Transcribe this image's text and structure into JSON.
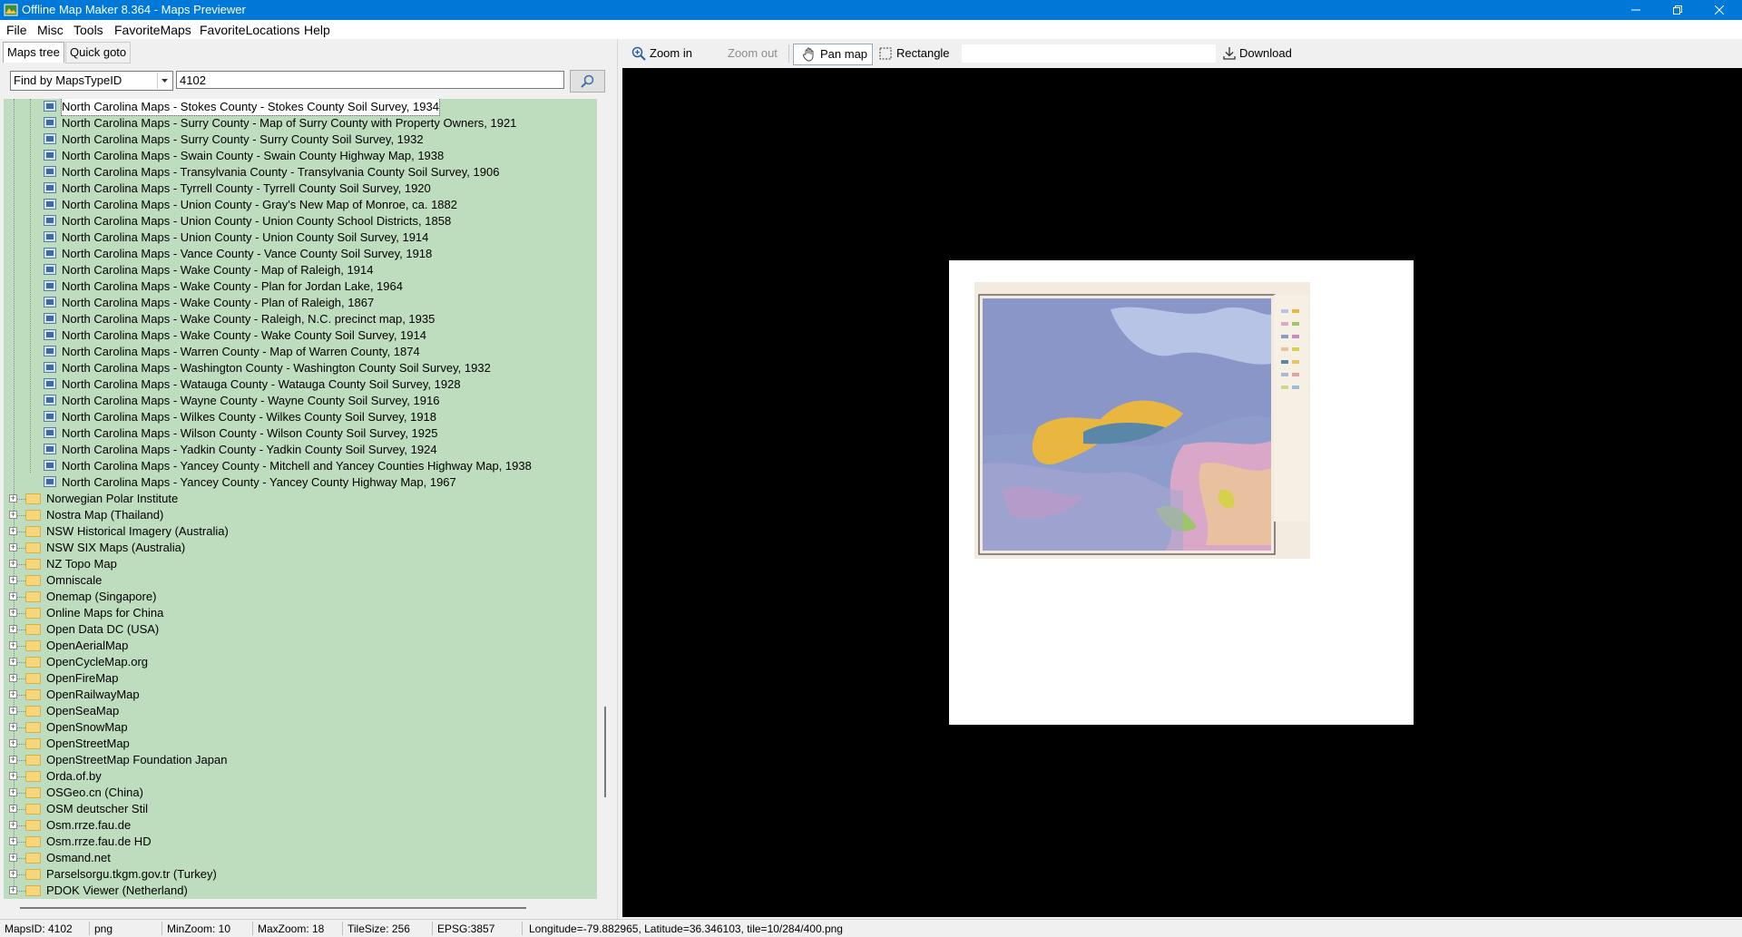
{
  "window": {
    "title": "Offline Map Maker 8.364 - Maps Previewer",
    "controls": [
      "minimize",
      "maximize",
      "close"
    ]
  },
  "menu": [
    {
      "label": "File"
    },
    {
      "label": "Misc"
    },
    {
      "label": "Tools"
    },
    {
      "label": "FavoriteMaps"
    },
    {
      "label": "FavoriteLocations"
    },
    {
      "label": "Help"
    }
  ],
  "left_panel": {
    "tabs": [
      {
        "label": "Maps tree",
        "active": true
      },
      {
        "label": "Quick goto",
        "active": false
      }
    ],
    "search": {
      "mode": "Find by MapsTypeID",
      "value": "4102"
    },
    "tree": {
      "child_items": [
        "North Carolina Maps - Stokes County - Stokes County Soil Survey, 1934",
        "North Carolina Maps - Surry County - Map of Surry County with Property Owners, 1921",
        "North Carolina Maps - Surry County - Surry County Soil Survey, 1932",
        "North Carolina Maps - Swain County - Swain County Highway Map, 1938",
        "North Carolina Maps - Transylvania County - Transylvania County Soil Survey, 1906",
        "North Carolina Maps - Tyrrell County - Tyrrell County Soil Survey, 1920",
        "North Carolina Maps - Union County - Gray's New Map of Monroe, ca. 1882",
        "North Carolina Maps - Union County - Union County School Districts, 1858",
        "North Carolina Maps - Union County - Union County Soil Survey, 1914",
        "North Carolina Maps - Vance County - Vance County Soil Survey, 1918",
        "North Carolina Maps - Wake County - Map of Raleigh, 1914",
        "North Carolina Maps - Wake County - Plan for Jordan Lake, 1964",
        "North Carolina Maps - Wake County - Plan of Raleigh, 1867",
        "North Carolina Maps - Wake County - Raleigh, N.C. precinct map, 1935",
        "North Carolina Maps - Wake County - Wake County Soil Survey, 1914",
        "North Carolina Maps - Warren County - Map of Warren County, 1874",
        "North Carolina Maps - Washington County - Washington County Soil Survey, 1932",
        "North Carolina Maps - Watauga County - Watauga County Soil Survey, 1928",
        "North Carolina Maps - Wayne County - Wayne County Soil Survey, 1916",
        "North Carolina Maps - Wilkes County - Wilkes County Soil Survey, 1918",
        "North Carolina Maps - Wilson County - Wilson County Soil Survey, 1925",
        "North Carolina Maps - Yadkin County - Yadkin County Soil Survey, 1924",
        "North Carolina Maps - Yancey County - Mitchell and Yancey Counties Highway Map, 1938",
        "North Carolina Maps - Yancey County - Yancey County Highway Map, 1967"
      ],
      "selected_child": 0,
      "folders": [
        "Norwegian Polar Institute",
        "Nostra Map (Thailand)",
        "NSW Historical Imagery (Australia)",
        "NSW SIX Maps (Australia)",
        "NZ Topo Map",
        "Omniscale",
        "Onemap (Singapore)",
        "Online Maps for China",
        "Open Data DC (USA)",
        "OpenAerialMap",
        "OpenCycleMap.org",
        "OpenFireMap",
        "OpenRailwayMap",
        "OpenSeaMap",
        "OpenSnowMap",
        "OpenStreetMap",
        "OpenStreetMap Foundation Japan",
        "Orda.of.by",
        "OSGeo.cn (China)",
        "OSM deutscher Stil",
        "Osm.rrze.fau.de",
        "Osm.rrze.fau.de HD",
        "Osmand.net",
        "Parselsorgu.tkgm.gov.tr (Turkey)",
        "PDOK Viewer (Netherland)"
      ]
    }
  },
  "toolbar": {
    "zoom_in": "Zoom in",
    "zoom_out": "Zoom out",
    "pan_map": "Pan map",
    "rectangle": "Rectangle",
    "download": "Download"
  },
  "status": {
    "maps_id": "MapsID: 4102",
    "format": "png",
    "min_zoom": "MinZoom: 10",
    "max_zoom": "MaxZoom: 18",
    "tile_size": "TileSize: 256",
    "epsg": "EPSG:3857",
    "location": "Longitude=-79.882965, Latitude=36.346103, tile=10/284/400.png"
  },
  "colors": {
    "titlebar": "#0078d7",
    "tree_background": "#bedcbe",
    "map_background": "#000000",
    "folder": "#f5d67a"
  }
}
